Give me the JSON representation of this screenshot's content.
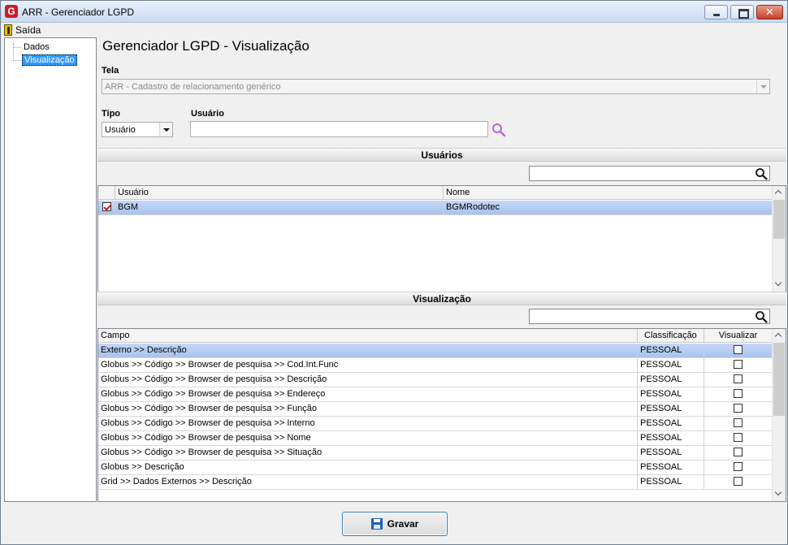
{
  "window": {
    "title": "ARR - Gerenciador LGPD",
    "app_icon_letter": "G",
    "close_glyph": "✕"
  },
  "menu": {
    "exit_label": "Saída"
  },
  "tree": {
    "items": [
      "Dados",
      "Visualização"
    ],
    "selected": "Visualização"
  },
  "page": {
    "title": "Gerenciador LGPD - Visualização"
  },
  "tela": {
    "label": "Tela",
    "value": "ARR - Cadastro de relacionamento genérico"
  },
  "tipo": {
    "label": "Tipo",
    "value": "Usuário"
  },
  "usuario": {
    "label": "Usuário",
    "value": ""
  },
  "usuarios_section": {
    "title": "Usuários",
    "filter_value": "",
    "columns": [
      "Usuário",
      "Nome"
    ],
    "rows": [
      {
        "checked": true,
        "usuario": "BGM",
        "nome": "BGMRodotec"
      }
    ]
  },
  "visualizacao_section": {
    "title": "Visualização",
    "filter_value": "",
    "columns": [
      "Campo",
      "Classificação",
      "Visualizar"
    ],
    "rows": [
      {
        "campo": "Externo >> Descrição",
        "classificacao": "PESSOAL",
        "visualizar": false
      },
      {
        "campo": "Globus >> Código >> Browser de pesquisa >> Cod.Int.Func",
        "classificacao": "PESSOAL",
        "visualizar": false
      },
      {
        "campo": "Globus >> Código >> Browser de pesquisa >> Descrição",
        "classificacao": "PESSOAL",
        "visualizar": false
      },
      {
        "campo": "Globus >> Código >> Browser de pesquisa >> Endereço",
        "classificacao": "PESSOAL",
        "visualizar": false
      },
      {
        "campo": "Globus >> Código >> Browser de pesquisa >> Função",
        "classificacao": "PESSOAL",
        "visualizar": false
      },
      {
        "campo": "Globus >> Código >> Browser de pesquisa >> Interno",
        "classificacao": "PESSOAL",
        "visualizar": false
      },
      {
        "campo": "Globus >> Código >> Browser de pesquisa >> Nome",
        "classificacao": "PESSOAL",
        "visualizar": false
      },
      {
        "campo": "Globus >> Código >> Browser de pesquisa >> Situação",
        "classificacao": "PESSOAL",
        "visualizar": false
      },
      {
        "campo": "Globus >> Descrição",
        "classificacao": "PESSOAL",
        "visualizar": false
      },
      {
        "campo": "Grid >> Dados Externos >>  Descrição",
        "classificacao": "PESSOAL",
        "visualizar": false
      }
    ]
  },
  "footer": {
    "save_label": "Gravar"
  },
  "icons": {
    "usuario_search": "magnifier-purple-icon",
    "filter_search": "magnifier-icon",
    "save": "floppy-disk-icon",
    "exit": "exit-door-icon"
  },
  "colors": {
    "selected_row": "#b8cef2",
    "tree_selected": "#3399ff",
    "checkbox_check": "#c0171a"
  }
}
